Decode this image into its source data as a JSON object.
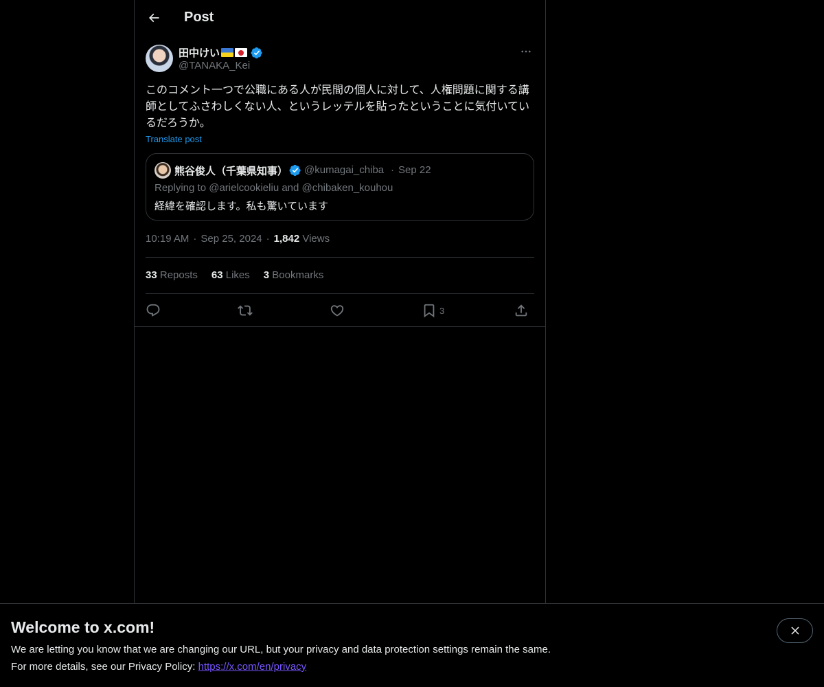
{
  "header": {
    "title": "Post"
  },
  "post": {
    "author_name": "田中けい",
    "author_handle": "@TANAKA_Kei",
    "text": "このコメント一つで公職にある人が民間の個人に対して、人権問題に関する講師としてふさわしくない人、というレッテルを貼ったということに気付いているだろうか。",
    "translate_label": "Translate post",
    "time": "10:19 AM",
    "date": "Sep 25, 2024",
    "views_count": "1,842",
    "views_label": "Views",
    "separator": "·"
  },
  "quote": {
    "name": "熊谷俊人（千葉県知事）",
    "handle": "@kumagai_chiba",
    "separator": "·",
    "date": "Sep 22",
    "reply_prefix": "Replying to",
    "reply_user1": "@arielcookieliu",
    "reply_and": "and",
    "reply_user2": "@chibaken_kouhou",
    "text": "経緯を確認します。私も驚いています"
  },
  "stats": {
    "reposts_count": "33",
    "reposts_label": "Reposts",
    "likes_count": "63",
    "likes_label": "Likes",
    "bookmarks_count": "3",
    "bookmarks_label": "Bookmarks"
  },
  "actions": {
    "bookmark_count": "3"
  },
  "banner": {
    "title": "Welcome to x.com!",
    "line1": "We are letting you know that we are changing our URL, but your privacy and data protection settings remain the same.",
    "line2_prefix": "For more details, see our Privacy Policy:",
    "link": "https://x.com/en/privacy"
  },
  "colors": {
    "background": "#000000",
    "accent": "#1d9bf0",
    "link": "#7856ff",
    "muted": "#71767b",
    "border": "#2f3336"
  },
  "icons": [
    "back-arrow-icon",
    "verified-badge-icon",
    "more-icon",
    "reply-icon",
    "repost-icon",
    "like-icon",
    "bookmark-icon",
    "share-icon",
    "close-icon",
    "flag-ukraine-icon",
    "flag-japan-icon"
  ]
}
